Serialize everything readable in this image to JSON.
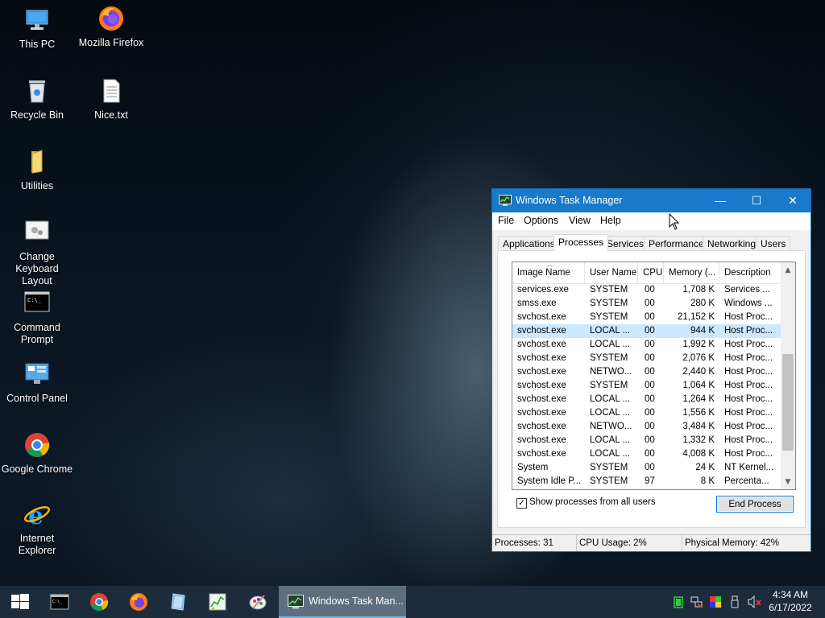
{
  "desktop": {
    "icons": [
      {
        "label": "This PC",
        "icon": "this-pc-icon"
      },
      {
        "label": "Mozilla Firefox",
        "icon": "firefox-icon"
      },
      {
        "label": "Recycle Bin",
        "icon": "recycle-bin-icon"
      },
      {
        "label": "Nice.txt",
        "icon": "text-file-icon"
      },
      {
        "label": "Utilities",
        "icon": "folder-icon"
      },
      {
        "label": "Change Keyboard Layout",
        "icon": "keyboard-layout-icon"
      },
      {
        "label": "Command Prompt",
        "icon": "cmd-icon"
      },
      {
        "label": "Control Panel",
        "icon": "control-panel-icon"
      },
      {
        "label": "Google Chrome",
        "icon": "chrome-icon"
      },
      {
        "label": "Internet Explorer",
        "icon": "ie-icon"
      }
    ]
  },
  "window": {
    "title": "Windows Task Manager",
    "controls": {
      "minimize": "—",
      "maximize": "☐",
      "close": "✕"
    },
    "menu": [
      "File",
      "Options",
      "View",
      "Help"
    ],
    "tabs": [
      "Applications",
      "Processes",
      "Services",
      "Performance",
      "Networking",
      "Users"
    ],
    "active_tab": "Processes",
    "columns": [
      "Image Name",
      "User Name",
      "CPU",
      "Memory (...",
      "Description"
    ],
    "processes": [
      {
        "image": "services.exe",
        "user": "SYSTEM",
        "cpu": "00",
        "mem": "1,708 K",
        "desc": "Services ..."
      },
      {
        "image": "smss.exe",
        "user": "SYSTEM",
        "cpu": "00",
        "mem": "280 K",
        "desc": "Windows ..."
      },
      {
        "image": "svchost.exe",
        "user": "SYSTEM",
        "cpu": "00",
        "mem": "21,152 K",
        "desc": "Host Proc..."
      },
      {
        "image": "svchost.exe",
        "user": "LOCAL ...",
        "cpu": "00",
        "mem": "944 K",
        "desc": "Host Proc...",
        "selected": true
      },
      {
        "image": "svchost.exe",
        "user": "LOCAL ...",
        "cpu": "00",
        "mem": "1,992 K",
        "desc": "Host Proc..."
      },
      {
        "image": "svchost.exe",
        "user": "SYSTEM",
        "cpu": "00",
        "mem": "2,076 K",
        "desc": "Host Proc..."
      },
      {
        "image": "svchost.exe",
        "user": "NETWO...",
        "cpu": "00",
        "mem": "2,440 K",
        "desc": "Host Proc..."
      },
      {
        "image": "svchost.exe",
        "user": "SYSTEM",
        "cpu": "00",
        "mem": "1,064 K",
        "desc": "Host Proc..."
      },
      {
        "image": "svchost.exe",
        "user": "LOCAL ...",
        "cpu": "00",
        "mem": "1,264 K",
        "desc": "Host Proc..."
      },
      {
        "image": "svchost.exe",
        "user": "LOCAL ...",
        "cpu": "00",
        "mem": "1,556 K",
        "desc": "Host Proc..."
      },
      {
        "image": "svchost.exe",
        "user": "NETWO...",
        "cpu": "00",
        "mem": "3,484 K",
        "desc": "Host Proc..."
      },
      {
        "image": "svchost.exe",
        "user": "LOCAL ...",
        "cpu": "00",
        "mem": "1,332 K",
        "desc": "Host Proc..."
      },
      {
        "image": "svchost.exe",
        "user": "LOCAL ...",
        "cpu": "00",
        "mem": "4,008 K",
        "desc": "Host Proc..."
      },
      {
        "image": "System",
        "user": "SYSTEM",
        "cpu": "00",
        "mem": "24 K",
        "desc": "NT Kernel..."
      },
      {
        "image": "System Idle P...",
        "user": "SYSTEM",
        "cpu": "97",
        "mem": "8 K",
        "desc": "Percenta..."
      }
    ],
    "show_all_users_label": "Show processes from all users",
    "show_all_users_checked": true,
    "end_process_label": "End Process",
    "status": {
      "processes": "Processes: 31",
      "cpu": "CPU Usage: 2%",
      "memory": "Physical Memory: 42%"
    }
  },
  "taskbar": {
    "pinned": [
      "start-icon",
      "cmd-icon",
      "chrome-icon",
      "firefox-icon",
      "notepad-icon",
      "taskmgr-chart-icon",
      "paint-icon"
    ],
    "active_window_label": "Windows Task Man...",
    "tray": [
      "battery-icon",
      "network-icon",
      "color-icon",
      "usb-icon",
      "volume-muted-icon"
    ],
    "time": "4:34 AM",
    "date": "6/17/2022"
  },
  "colors": {
    "title_bar": "#1979ca",
    "selected_row": "#cce8ff",
    "taskbar": "#1c2c3c",
    "active_taskbar_item": "#5d6e7e"
  }
}
